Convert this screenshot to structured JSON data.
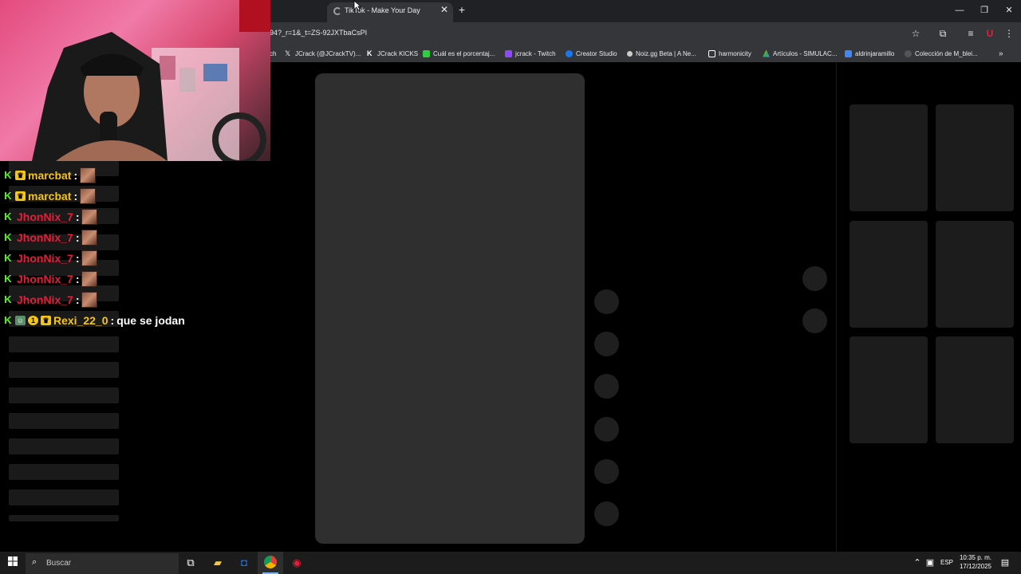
{
  "browser": {
    "tab_title": "TikTok - Make Your Day",
    "url": "94?_r=1&_t=ZS-92JXTbaCsPI",
    "window_controls": {
      "minimize": "—",
      "maximize": "❐",
      "close": "✕"
    },
    "new_tab": "+",
    "tab_close": "✕",
    "bookmarks": [
      {
        "label": "ch",
        "icon": "twitch-icon",
        "color": "#9146ff"
      },
      {
        "label": "JCrack (@JCrackTV)...",
        "icon": "x-icon",
        "color": "#ffffff"
      },
      {
        "label": "JCrack KICKS",
        "icon": "k-icon",
        "color": "#ffffff"
      },
      {
        "label": "Cuál es el porcentaj...",
        "icon": "d-icon",
        "color": "#2ecc40"
      },
      {
        "label": "jcrack - Twitch",
        "icon": "twitch-icon",
        "color": "#9146ff"
      },
      {
        "label": "Creator Studio",
        "icon": "facebook-icon",
        "color": "#1877f2"
      },
      {
        "label": "Noiz.gg Beta | A Ne...",
        "icon": "noiz-icon",
        "color": "#cccccc"
      },
      {
        "label": "harmonicity",
        "icon": "document-icon",
        "color": "#ffffff"
      },
      {
        "label": "Artículos - SIMULAC...",
        "icon": "drive-icon",
        "color": "#34a853"
      },
      {
        "label": "aldrinjaramillo",
        "icon": "page-icon",
        "color": "#4285f4"
      },
      {
        "label": "Colección de M_blei...",
        "icon": "globe-icon",
        "color": "#555555"
      }
    ],
    "bookmarks_overflow": "»"
  },
  "chat": {
    "messages": [
      {
        "user": "marcbat",
        "color": "#f5c518",
        "badges": [
          "kick",
          "crown"
        ],
        "text": ""
      },
      {
        "user": "marcbat",
        "color": "#f5c518",
        "badges": [
          "kick",
          "crown"
        ],
        "text": ""
      },
      {
        "user": "JhonNix_7",
        "color": "#e0203a",
        "badges": [
          "kick"
        ],
        "text": ""
      },
      {
        "user": "JhonNix_7",
        "color": "#e0203a",
        "badges": [
          "kick"
        ],
        "text": ""
      },
      {
        "user": "JhonNix_7",
        "color": "#e0203a",
        "badges": [
          "kick"
        ],
        "text": ""
      },
      {
        "user": "JhonNix_7",
        "color": "#e0203a",
        "badges": [
          "kick"
        ],
        "text": ""
      },
      {
        "user": "JhonNix_7",
        "color": "#e0203a",
        "badges": [
          "kick"
        ],
        "text": ""
      },
      {
        "user": "Rexi_22_0",
        "color": "#f5c518",
        "badges": [
          "kick",
          "bot",
          "one",
          "crown"
        ],
        "text": "que se jodan"
      }
    ],
    "separator": ":"
  },
  "taskbar": {
    "search_placeholder": "Buscar",
    "language": "ESP",
    "time": "10:35 p. m.",
    "date": "17/12/2025"
  }
}
